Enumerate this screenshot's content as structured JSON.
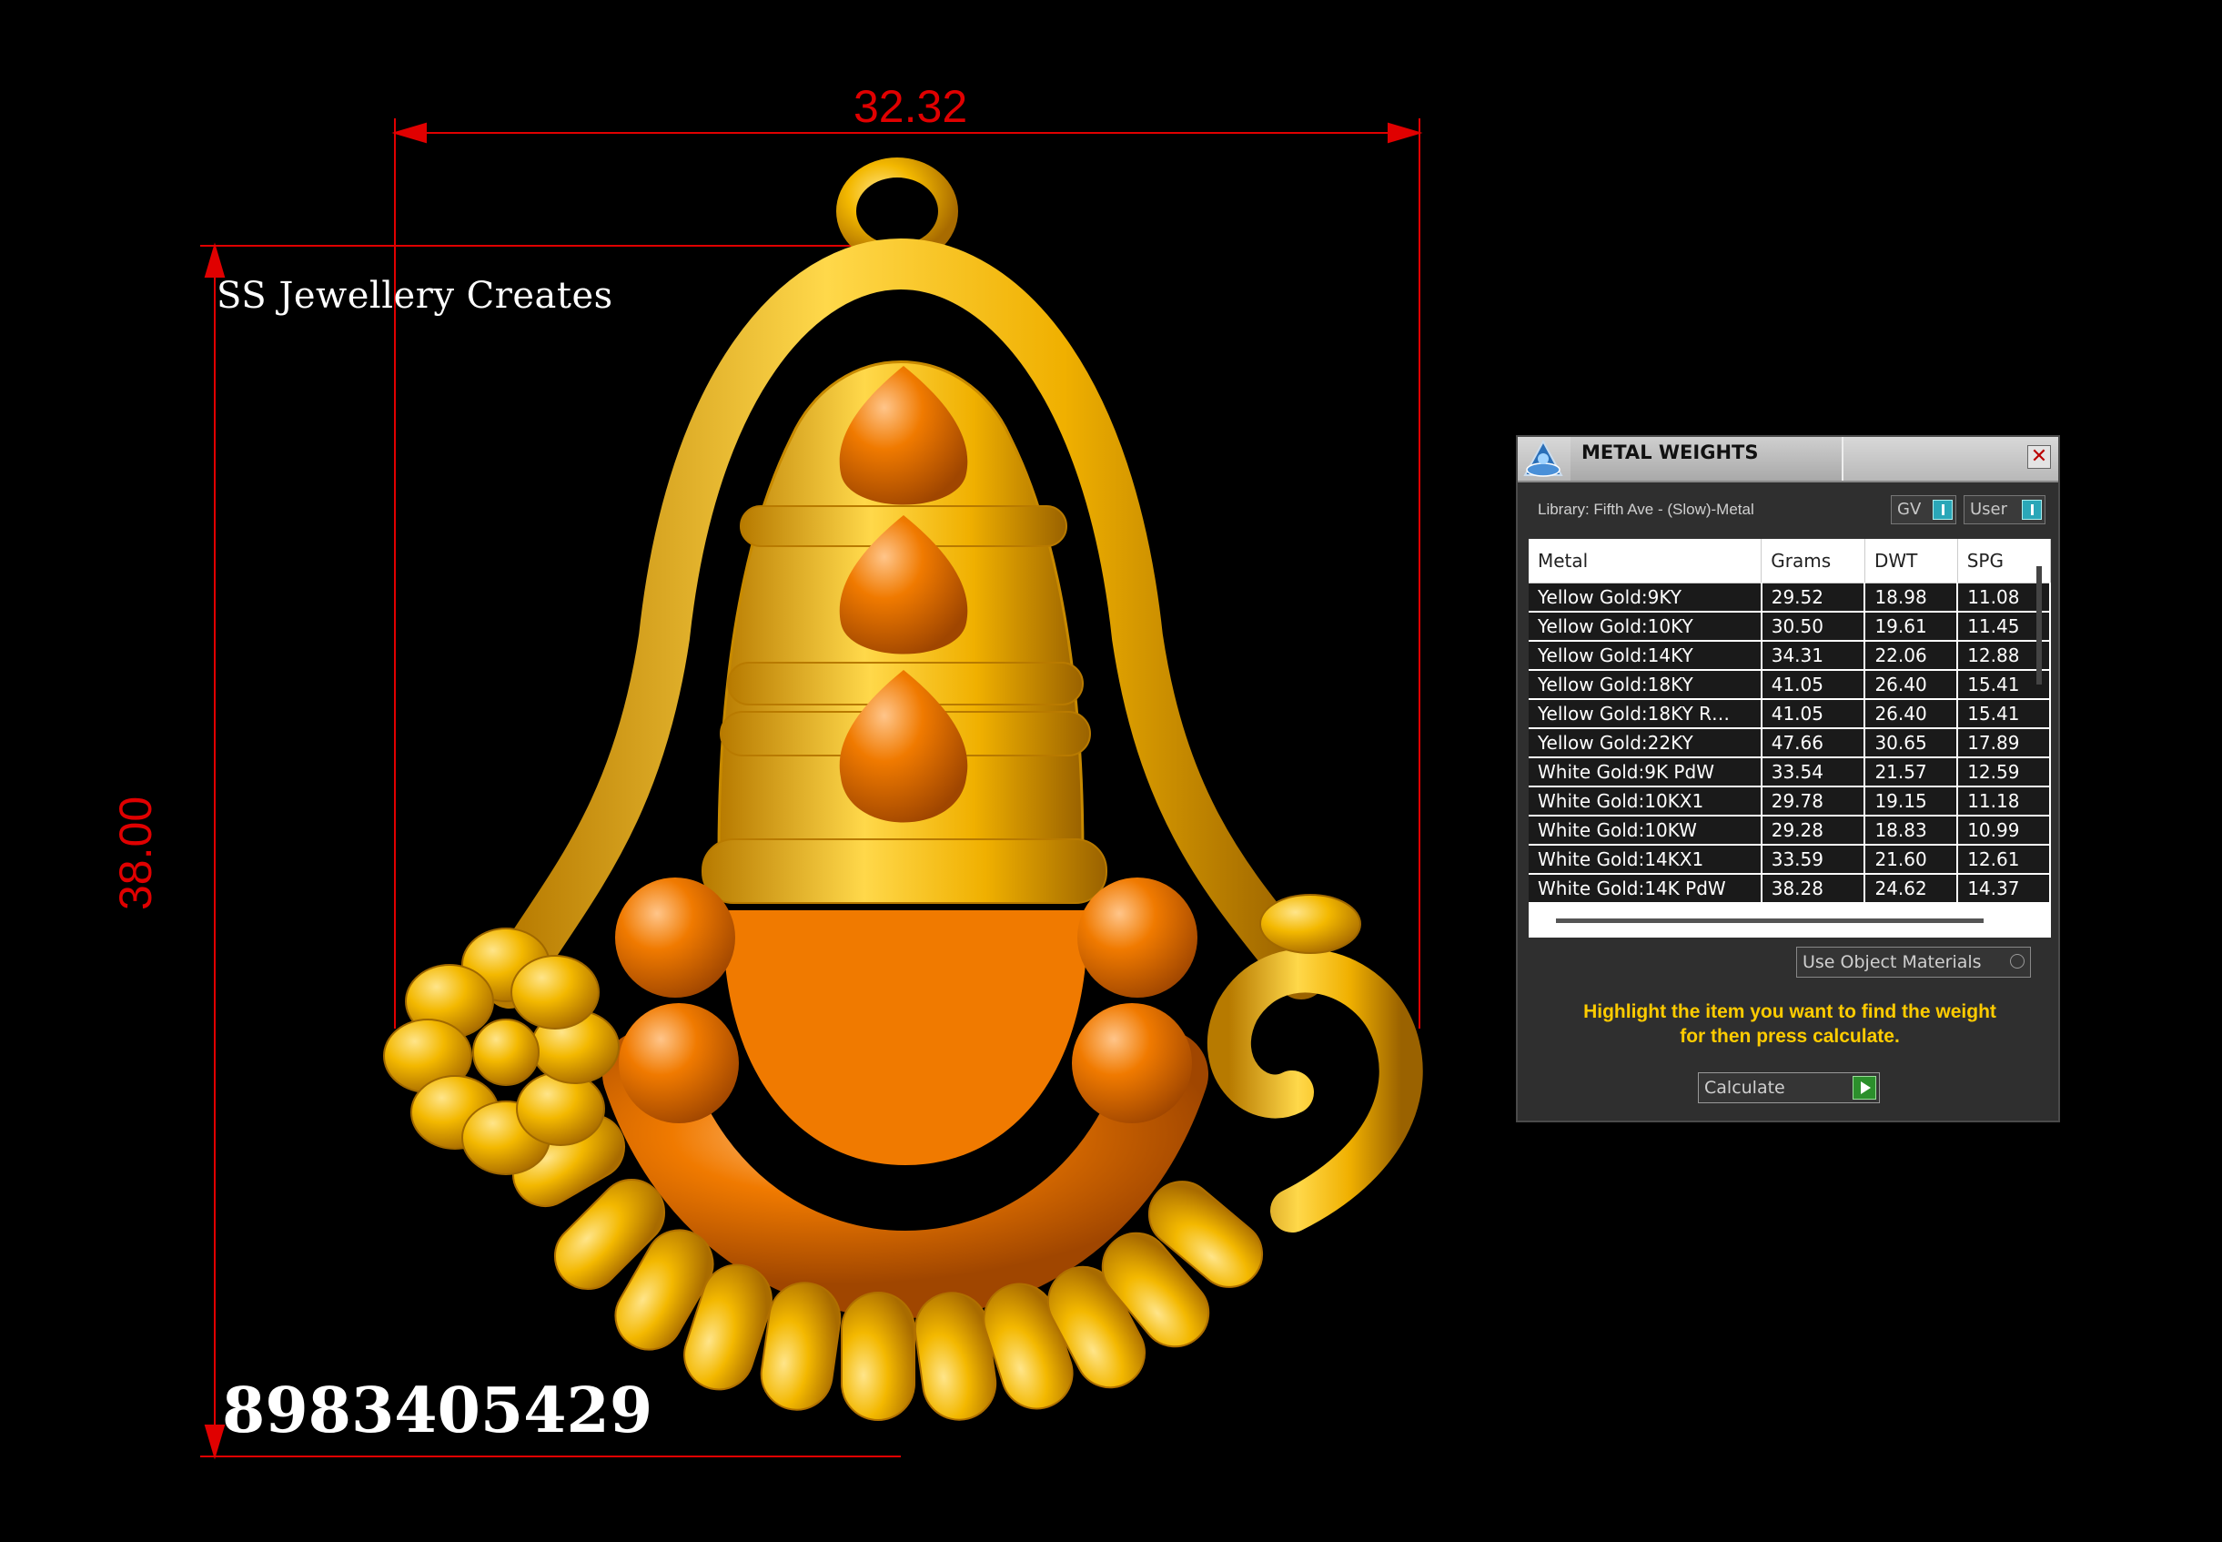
{
  "canvas": {
    "brand_text": "SS Jewellery Creates",
    "phone_text": "8983405429",
    "dimension_width": "32.32",
    "dimension_height": "38.00",
    "colors": {
      "background": "#000000",
      "gold": "#f2b400",
      "orange": "#f07a00",
      "dimension_line": "#e00000"
    }
  },
  "panel": {
    "title": "METAL WEIGHTS",
    "app_icon": "app-icon",
    "close_label": "✕",
    "library_label": "Library: Fifth Ave - (Slow)-Metal",
    "toggle_gv_label": "GV",
    "toggle_user_label": "User",
    "table": {
      "columns": [
        "Metal",
        "Grams",
        "DWT",
        "SPG"
      ],
      "rows": [
        [
          "Yellow Gold:9KY",
          "29.52",
          "18.98",
          "11.08"
        ],
        [
          "Yellow Gold:10KY",
          "30.50",
          "19.61",
          "11.45"
        ],
        [
          "Yellow Gold:14KY",
          "34.31",
          "22.06",
          "12.88"
        ],
        [
          "Yellow Gold:18KY",
          "41.05",
          "26.40",
          "15.41"
        ],
        [
          "Yellow Gold:18KY R…",
          "41.05",
          "26.40",
          "15.41"
        ],
        [
          "Yellow Gold:22KY",
          "47.66",
          "30.65",
          "17.89"
        ],
        [
          "White Gold:9K PdW",
          "33.54",
          "21.57",
          "12.59"
        ],
        [
          "White Gold:10KX1",
          "29.78",
          "19.15",
          "11.18"
        ],
        [
          "White Gold:10KW",
          "29.28",
          "18.83",
          "10.99"
        ],
        [
          "White Gold:14KX1",
          "33.59",
          "21.60",
          "12.61"
        ],
        [
          "White Gold:14K PdW",
          "38.28",
          "24.62",
          "14.37"
        ]
      ]
    },
    "use_object_materials_label": "Use Object Materials",
    "hint_line1": "Highlight the item you want to find the weight",
    "hint_line2": "for then press calculate.",
    "calculate_label": "Calculate"
  }
}
